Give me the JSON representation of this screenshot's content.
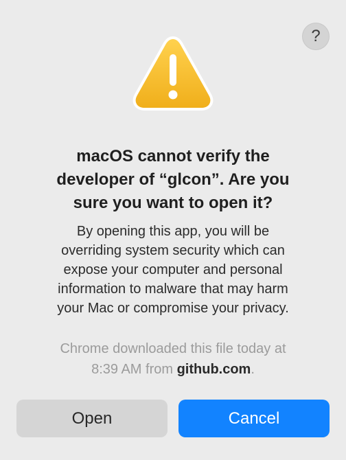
{
  "dialog": {
    "help_label": "?",
    "title_lines": [
      "macOS cannot verify the",
      "developer of “glcon”. Are you",
      "sure you want to open it?"
    ],
    "message_lines": [
      "By opening this app, you will be",
      "overriding system security which can",
      "expose your computer and personal",
      "information to malware that may harm",
      "your Mac or compromise your privacy."
    ],
    "source": {
      "line1": "Chrome downloaded this file today at",
      "line2_prefix": "8:39 AM from ",
      "domain": "github.com",
      "line2_suffix": "."
    },
    "buttons": {
      "open_label": "Open",
      "cancel_label": "Cancel"
    },
    "icons": {
      "alert": "warning-triangle-icon",
      "help": "question-mark-icon"
    },
    "colors": {
      "background": "#ebebeb",
      "primary_button": "#1283ff",
      "secondary_button": "#d5d5d5",
      "warning_fill": "#f6b72b"
    }
  }
}
